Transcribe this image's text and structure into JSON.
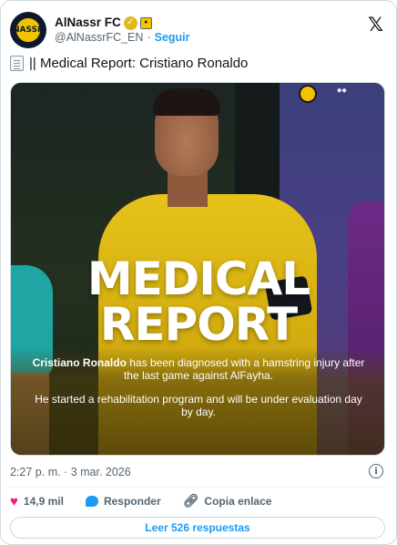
{
  "account": {
    "display_name": "AlNassr FC",
    "handle": "@AlNassrFC_EN",
    "separator": "·",
    "follow_label": "Seguir",
    "avatar_text": "NASSR"
  },
  "tweet": {
    "text": "|| Medical Report: Cristiano Ronaldo",
    "timestamp": "2:27 p. m. · 3 mar. 2026"
  },
  "media": {
    "title_line1": "MEDICAL",
    "title_line2": "REPORT",
    "caption_name": "Cristiano Ronaldo",
    "caption_rest": " has been diagnosed with a hamstring injury after the last game against AlFayha.",
    "caption2": "He started a rehabilitation program and will be under evaluation day by day."
  },
  "actions": {
    "likes": "14,9 mil",
    "reply_label": "Responder",
    "copy_label": "Copia enlace"
  },
  "replies_button": "Leer 526 respuestas",
  "colors": {
    "accent": "#1d9bf0",
    "like": "#f91880",
    "verified_gold": "#e2b719",
    "jersey_yellow": "#e6c21a"
  },
  "icons": {
    "brand": "x-logo-icon",
    "verified": "verified-badge-icon",
    "affiliation": "affiliation-badge-icon",
    "document": "document-icon",
    "info": "info-icon",
    "like": "heart-icon",
    "reply": "reply-bubble-icon",
    "copy": "link-icon"
  }
}
